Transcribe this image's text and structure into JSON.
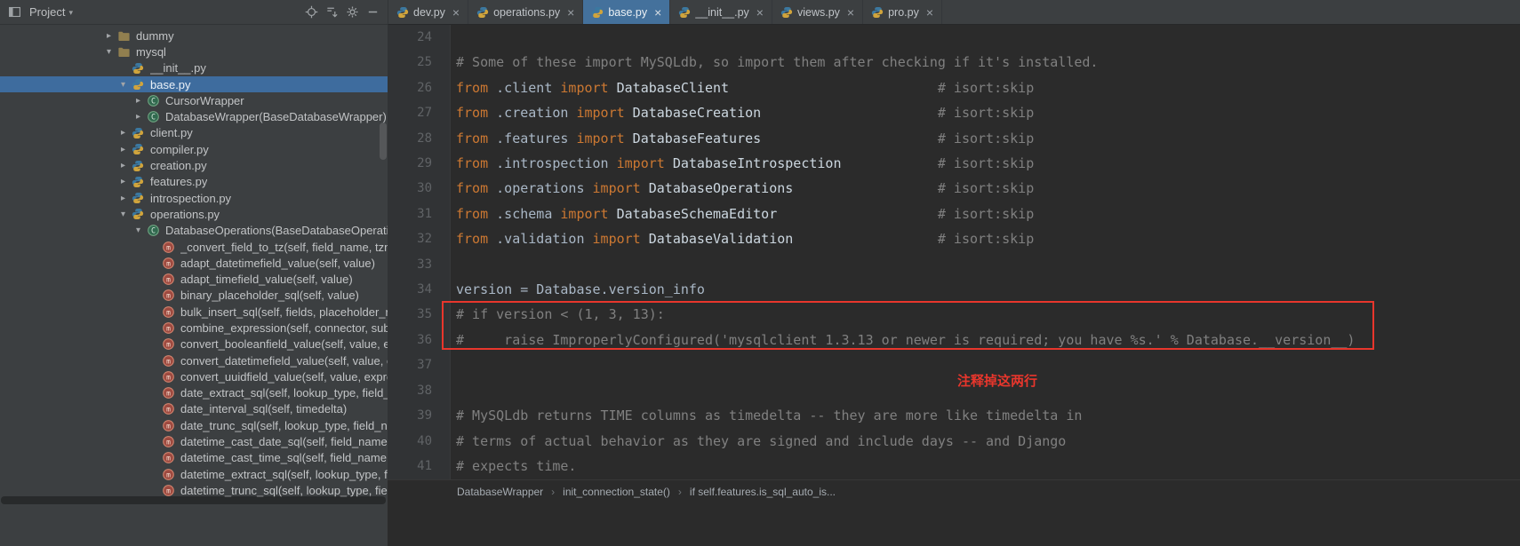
{
  "colors": {
    "panel_bg": "#3c3f41",
    "editor_bg": "#2b2b2b",
    "gutter_bg": "#313335",
    "tree_selection_blue": "#3e6c9e",
    "active_tab_blue": "#44719c",
    "keyword_orange": "#cc7832",
    "comment_gray": "#808080",
    "plain_text": "#a9b7c6",
    "annotation_red": "#e8362c"
  },
  "project_panel": {
    "title": "Project",
    "title_caret": "▾",
    "header_icons": [
      {
        "name": "locate-file-icon"
      },
      {
        "name": "collapse-all-icon"
      },
      {
        "name": "settings-gear-icon"
      },
      {
        "name": "hide-panel-icon"
      }
    ],
    "tree": [
      {
        "label": "dummy",
        "icon": "folder",
        "arrow": "right",
        "indent": 114
      },
      {
        "label": "mysql",
        "icon": "folder",
        "arrow": "down",
        "indent": 114
      },
      {
        "label": "__init__.py",
        "icon": "python",
        "arrow": "none",
        "indent": 130
      },
      {
        "label": "base.py",
        "icon": "python",
        "arrow": "down",
        "indent": 130,
        "selected": true
      },
      {
        "label": "CursorWrapper",
        "icon": "class",
        "arrow": "right",
        "indent": 147
      },
      {
        "label": "DatabaseWrapper(BaseDatabaseWrapper)",
        "icon": "class",
        "arrow": "right",
        "indent": 147
      },
      {
        "label": "client.py",
        "icon": "python",
        "arrow": "right",
        "indent": 130
      },
      {
        "label": "compiler.py",
        "icon": "python",
        "arrow": "right",
        "indent": 130
      },
      {
        "label": "creation.py",
        "icon": "python",
        "arrow": "right",
        "indent": 130
      },
      {
        "label": "features.py",
        "icon": "python",
        "arrow": "right",
        "indent": 130
      },
      {
        "label": "introspection.py",
        "icon": "python",
        "arrow": "right",
        "indent": 130
      },
      {
        "label": "operations.py",
        "icon": "python",
        "arrow": "down",
        "indent": 130
      },
      {
        "label": "DatabaseOperations(BaseDatabaseOperations)",
        "icon": "class",
        "arrow": "down",
        "indent": 147
      },
      {
        "label": "_convert_field_to_tz(self, field_name, tzname)",
        "icon": "method",
        "arrow": "none",
        "indent": 164
      },
      {
        "label": "adapt_datetimefield_value(self, value)",
        "icon": "method",
        "arrow": "none",
        "indent": 164
      },
      {
        "label": "adapt_timefield_value(self, value)",
        "icon": "method",
        "arrow": "none",
        "indent": 164
      },
      {
        "label": "binary_placeholder_sql(self, value)",
        "icon": "method",
        "arrow": "none",
        "indent": 164
      },
      {
        "label": "bulk_insert_sql(self, fields, placeholder_rows)",
        "icon": "method",
        "arrow": "none",
        "indent": 164
      },
      {
        "label": "combine_expression(self, connector, sub_expressions)",
        "icon": "method",
        "arrow": "none",
        "indent": 164
      },
      {
        "label": "convert_booleanfield_value(self, value, expression, connection)",
        "icon": "method",
        "arrow": "none",
        "indent": 164
      },
      {
        "label": "convert_datetimefield_value(self, value, expression, connection)",
        "icon": "method",
        "arrow": "none",
        "indent": 164
      },
      {
        "label": "convert_uuidfield_value(self, value, expression, connection)",
        "icon": "method",
        "arrow": "none",
        "indent": 164
      },
      {
        "label": "date_extract_sql(self, lookup_type, field_name)",
        "icon": "method",
        "arrow": "none",
        "indent": 164
      },
      {
        "label": "date_interval_sql(self, timedelta)",
        "icon": "method",
        "arrow": "none",
        "indent": 164
      },
      {
        "label": "date_trunc_sql(self, lookup_type, field_name)",
        "icon": "method",
        "arrow": "none",
        "indent": 164
      },
      {
        "label": "datetime_cast_date_sql(self, field_name, tzname)",
        "icon": "method",
        "arrow": "none",
        "indent": 164
      },
      {
        "label": "datetime_cast_time_sql(self, field_name, tzname)",
        "icon": "method",
        "arrow": "none",
        "indent": 164
      },
      {
        "label": "datetime_extract_sql(self, lookup_type, field_name, tzname)",
        "icon": "method",
        "arrow": "none",
        "indent": 164
      },
      {
        "label": "datetime_trunc_sql(self, lookup_type, field_name, tzname)",
        "icon": "method",
        "arrow": "none",
        "indent": 164
      }
    ]
  },
  "editor_tabs": [
    {
      "label": "dev.py",
      "close": "×",
      "active": false
    },
    {
      "label": "operations.py",
      "close": "×",
      "active": false
    },
    {
      "label": "base.py",
      "close": "×",
      "active": true
    },
    {
      "label": "__init__.py",
      "close": "×",
      "active": false
    },
    {
      "label": "views.py",
      "close": "×",
      "active": false
    },
    {
      "label": "pro.py",
      "close": "×",
      "active": false
    }
  ],
  "editor": {
    "lines": [
      {
        "num": "24",
        "segments": []
      },
      {
        "num": "25",
        "segments": [
          {
            "c": "c",
            "t": "# Some of these import MySQLdb, so import them after checking if it's installed."
          }
        ]
      },
      {
        "num": "26",
        "segments": [
          {
            "c": "k",
            "t": "from"
          },
          {
            "c": "p",
            "t": " .client "
          },
          {
            "c": "k",
            "t": "import"
          },
          {
            "c": "w",
            "t": " DatabaseClient"
          },
          {
            "c": "p",
            "t": "                          "
          },
          {
            "c": "c",
            "t": "# isort:skip"
          }
        ]
      },
      {
        "num": "27",
        "segments": [
          {
            "c": "k",
            "t": "from"
          },
          {
            "c": "p",
            "t": " .creation "
          },
          {
            "c": "k",
            "t": "import"
          },
          {
            "c": "w",
            "t": " DatabaseCreation"
          },
          {
            "c": "p",
            "t": "                      "
          },
          {
            "c": "c",
            "t": "# isort:skip"
          }
        ]
      },
      {
        "num": "28",
        "segments": [
          {
            "c": "k",
            "t": "from"
          },
          {
            "c": "p",
            "t": " .features "
          },
          {
            "c": "k",
            "t": "import"
          },
          {
            "c": "w",
            "t": " DatabaseFeatures"
          },
          {
            "c": "p",
            "t": "                      "
          },
          {
            "c": "c",
            "t": "# isort:skip"
          }
        ]
      },
      {
        "num": "29",
        "segments": [
          {
            "c": "k",
            "t": "from"
          },
          {
            "c": "p",
            "t": " .introspection "
          },
          {
            "c": "k",
            "t": "import"
          },
          {
            "c": "w",
            "t": " DatabaseIntrospection"
          },
          {
            "c": "p",
            "t": "            "
          },
          {
            "c": "c",
            "t": "# isort:skip"
          }
        ]
      },
      {
        "num": "30",
        "segments": [
          {
            "c": "k",
            "t": "from"
          },
          {
            "c": "p",
            "t": " .operations "
          },
          {
            "c": "k",
            "t": "import"
          },
          {
            "c": "w",
            "t": " DatabaseOperations"
          },
          {
            "c": "p",
            "t": "                  "
          },
          {
            "c": "c",
            "t": "# isort:skip"
          }
        ]
      },
      {
        "num": "31",
        "segments": [
          {
            "c": "k",
            "t": "from"
          },
          {
            "c": "p",
            "t": " .schema "
          },
          {
            "c": "k",
            "t": "import"
          },
          {
            "c": "w",
            "t": " DatabaseSchemaEditor"
          },
          {
            "c": "p",
            "t": "                    "
          },
          {
            "c": "c",
            "t": "# isort:skip"
          }
        ]
      },
      {
        "num": "32",
        "segments": [
          {
            "c": "k",
            "t": "from"
          },
          {
            "c": "p",
            "t": " .validation "
          },
          {
            "c": "k",
            "t": "import"
          },
          {
            "c": "w",
            "t": " DatabaseValidation"
          },
          {
            "c": "p",
            "t": "                  "
          },
          {
            "c": "c",
            "t": "# isort:skip"
          }
        ]
      },
      {
        "num": "33",
        "segments": []
      },
      {
        "num": "34",
        "segments": [
          {
            "c": "p",
            "t": "version = Database.version_info"
          }
        ]
      },
      {
        "num": "35",
        "fold": true,
        "segments": [
          {
            "c": "c",
            "t": "# if version < (1, 3, 13):"
          }
        ]
      },
      {
        "num": "36",
        "segments": [
          {
            "c": "c",
            "t": "#     raise ImproperlyConfigured('mysqlclient 1.3.13 or newer is required; you have %s.' % Database.__version__)"
          }
        ]
      },
      {
        "num": "37",
        "segments": []
      },
      {
        "num": "38",
        "segments": []
      },
      {
        "num": "39",
        "segments": [
          {
            "c": "c",
            "t": "# MySQLdb returns TIME columns as timedelta -- they are more like timedelta in"
          }
        ]
      },
      {
        "num": "40",
        "segments": [
          {
            "c": "c",
            "t": "# terms of actual behavior as they are signed and include days -- and Django"
          }
        ]
      },
      {
        "num": "41",
        "fold": true,
        "segments": [
          {
            "c": "c",
            "t": "# expects time."
          }
        ]
      }
    ]
  },
  "annotation": {
    "note": "注释掉这两行"
  },
  "breadcrumbs": {
    "separator": "›",
    "items": [
      "DatabaseWrapper",
      "init_connection_state()",
      "if self.features.is_sql_auto_is..."
    ]
  }
}
